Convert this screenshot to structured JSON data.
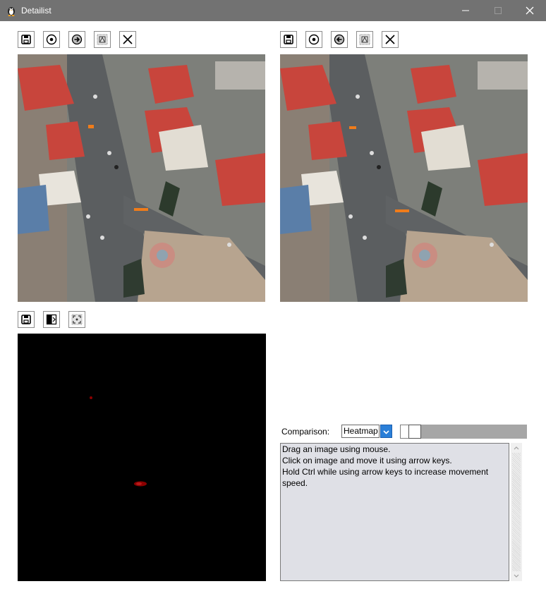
{
  "window": {
    "title": "Detailist",
    "app_icon": "penguin-app-icon",
    "controls": [
      "minimize-icon",
      "maximize-icon",
      "close-icon"
    ]
  },
  "left_toolbar": {
    "icons": [
      "save-icon",
      "center-target-icon",
      "arrow-right-circle-icon",
      "auto-align-icon",
      "close-icon"
    ]
  },
  "right_toolbar": {
    "icons": [
      "save-icon",
      "center-target-icon",
      "arrow-left-circle-icon",
      "auto-align-icon",
      "close-icon"
    ]
  },
  "heatmap_toolbar": {
    "icons": [
      "save-icon",
      "swap-images-icon",
      "fit-view-icon"
    ]
  },
  "comparison": {
    "label": "Comparison:",
    "selected": "Heatmap"
  },
  "info": {
    "lines": [
      "Drag an image using mouse.",
      "Click on image and move it using arrow keys.",
      "Hold Ctrl while using arrow keys to increase movement speed."
    ]
  },
  "colors": {
    "titlebar": "#727272",
    "heatmap_bg": "#000000",
    "heatmap_spot": "#8b0000",
    "roof_red": "#c8453c",
    "info_bg": "#dfe0e6",
    "select_arrow": "#2a7fd8"
  }
}
